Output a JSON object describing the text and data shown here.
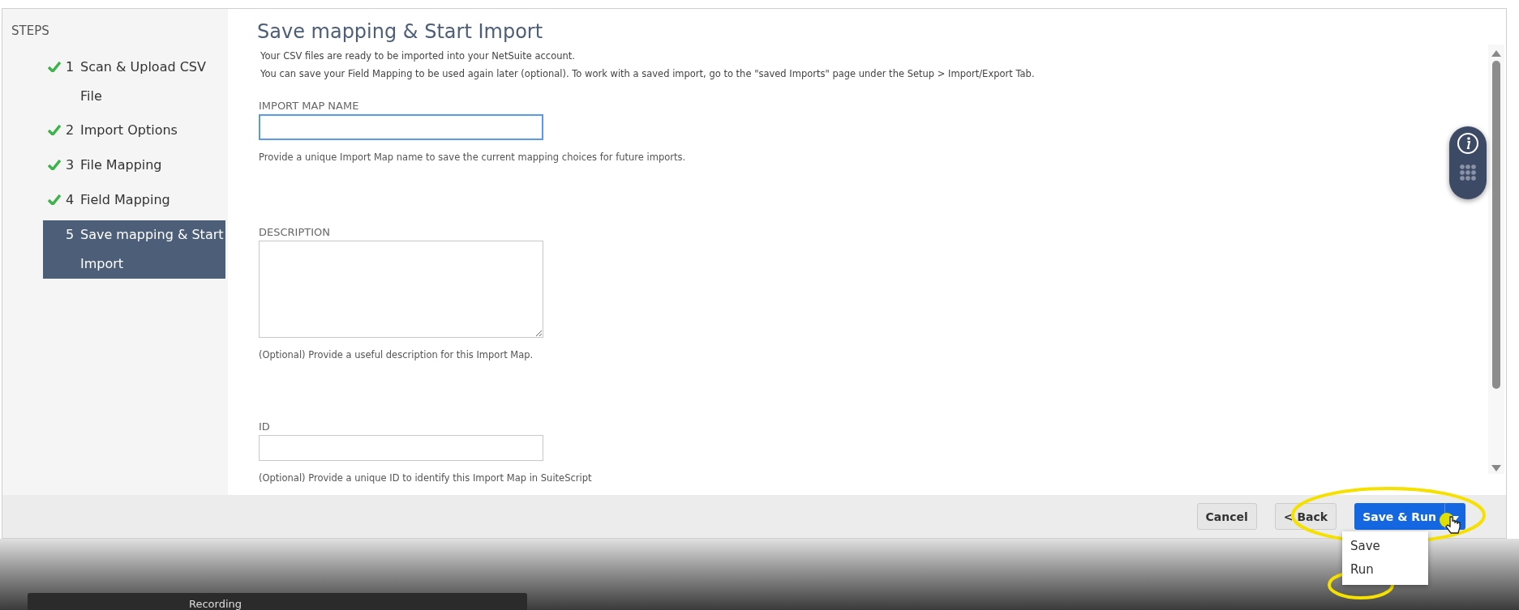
{
  "steps_panel": {
    "title": "STEPS",
    "steps": [
      {
        "number": "1",
        "label": "Scan & Upload CSV File",
        "completed": true,
        "selected": false
      },
      {
        "number": "2",
        "label": "Import Options",
        "completed": true,
        "selected": false
      },
      {
        "number": "3",
        "label": "File Mapping",
        "completed": true,
        "selected": false
      },
      {
        "number": "4",
        "label": "Field Mapping",
        "completed": true,
        "selected": false
      },
      {
        "number": "5",
        "label": "Save mapping & Start Import",
        "completed": false,
        "selected": true
      }
    ]
  },
  "page": {
    "title": "Save mapping & Start Import",
    "intro": [
      "Your CSV files are ready to be imported into your NetSuite account.",
      "You can save your Field Mapping to be used again later (optional). To work with a saved import, go to the \"saved Imports\" page under the Setup > Import/Export Tab."
    ],
    "fields": [
      {
        "label": "IMPORT MAP NAME",
        "kind": "input",
        "focused": true,
        "help": "Provide a unique Import Map name to save the current mapping choices for future imports."
      },
      {
        "label": "DESCRIPTION",
        "kind": "textarea",
        "focused": false,
        "help": "(Optional) Provide a useful description for this Import Map."
      },
      {
        "label": "ID",
        "kind": "input",
        "focused": false,
        "help": "(Optional) Provide a unique ID to identify this Import Map in SuiteScript"
      }
    ]
  },
  "footer": {
    "buttons": [
      {
        "label": "Cancel",
        "kind": "plain"
      },
      {
        "label": "< Back",
        "kind": "plain"
      },
      {
        "label": "Save & Run",
        "kind": "split"
      }
    ],
    "menu": [
      {
        "label": "Save"
      },
      {
        "label": "Run"
      }
    ]
  },
  "recorder": {
    "label": "Recording"
  }
}
